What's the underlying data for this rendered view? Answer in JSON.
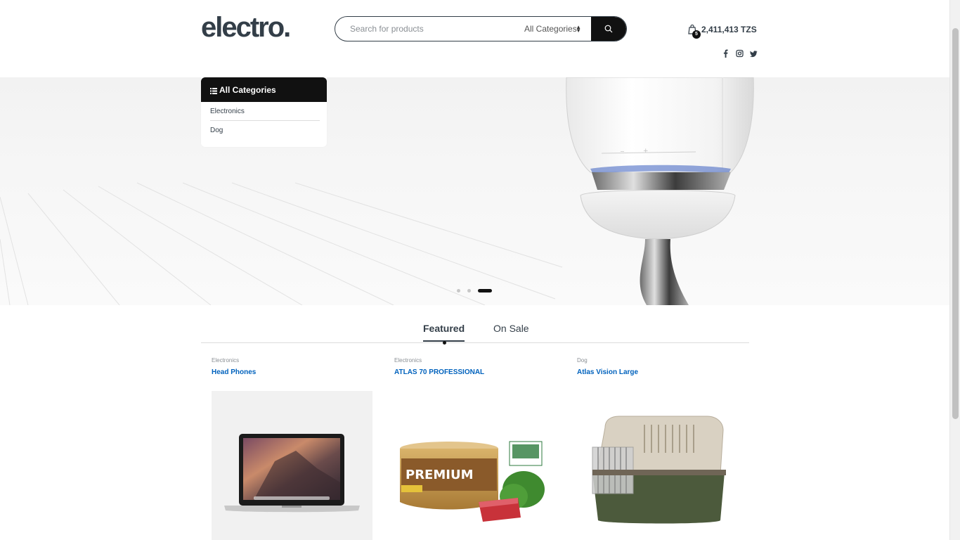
{
  "header": {
    "logo": "electro",
    "logo_dot": ".",
    "search_placeholder": "Search for products",
    "category_select": "All Categories",
    "cart_count": "5",
    "cart_total": "2,411,413 TZS",
    "icons": [
      "search-icon",
      "cart-bag-icon",
      "facebook-icon",
      "instagram-icon",
      "twitter-icon"
    ]
  },
  "categories": {
    "title": "All Categories",
    "items": [
      "Electronics",
      "Dog"
    ]
  },
  "hero": {
    "slide_count": 3,
    "active_slide": 3
  },
  "tabs": {
    "items": [
      "Featured",
      "On Sale"
    ],
    "active": "Featured"
  },
  "products": [
    {
      "category": "Electronics",
      "name": "Head Phones",
      "image": "laptop"
    },
    {
      "category": "Electronics",
      "name": "ATLAS 70 PROFESSIONAL",
      "image": "premium-tuna-can"
    },
    {
      "category": "Dog",
      "name": "Atlas Vision Large",
      "image": "pet-carrier"
    }
  ],
  "colors": {
    "primary": "#111111",
    "link": "#0062bd",
    "text": "#333e48"
  }
}
